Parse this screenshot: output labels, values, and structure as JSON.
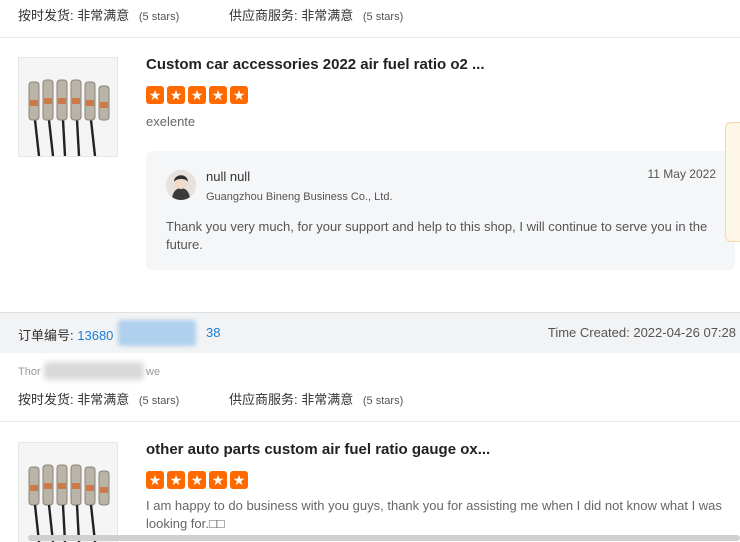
{
  "ratings_top": {
    "delivery_label": "按时发货:",
    "delivery_value": "非常满意",
    "delivery_stars": "(5 stars)",
    "service_label": "供应商服务:",
    "service_value": "非常满意",
    "service_stars": "(5 stars)"
  },
  "review1": {
    "title": "Custom car accessories 2022 air fuel ratio o2 ...",
    "rating": 5,
    "text": "exelente",
    "reply": {
      "name": "null null",
      "company": "Guangzhou Bineng Business Co., Ltd.",
      "date": "11 May 2022",
      "text": "Thank you very much, for your support and help to this shop, I will continue to serve you in the future."
    }
  },
  "order2": {
    "order_label": "订单编号:",
    "order_prefix": "13680",
    "order_suffix": "38",
    "time_created": "Time Created: 2022-04-26 07:28",
    "buyer_prefix": "Thor",
    "buyer_suffix": "we"
  },
  "ratings_bottom": {
    "delivery_label": "按时发货:",
    "delivery_value": "非常满意",
    "delivery_stars": "(5 stars)",
    "service_label": "供应商服务:",
    "service_value": "非常满意",
    "service_stars": "(5 stars)"
  },
  "review2": {
    "title": "other auto parts custom air fuel ratio gauge ox...",
    "rating": 5,
    "text": "I am happy to do business with you guys, thank you for assisting me when I did not know what I was looking for.□□"
  },
  "colors": {
    "star": "#ff6a00",
    "link": "#1a7fd6"
  }
}
